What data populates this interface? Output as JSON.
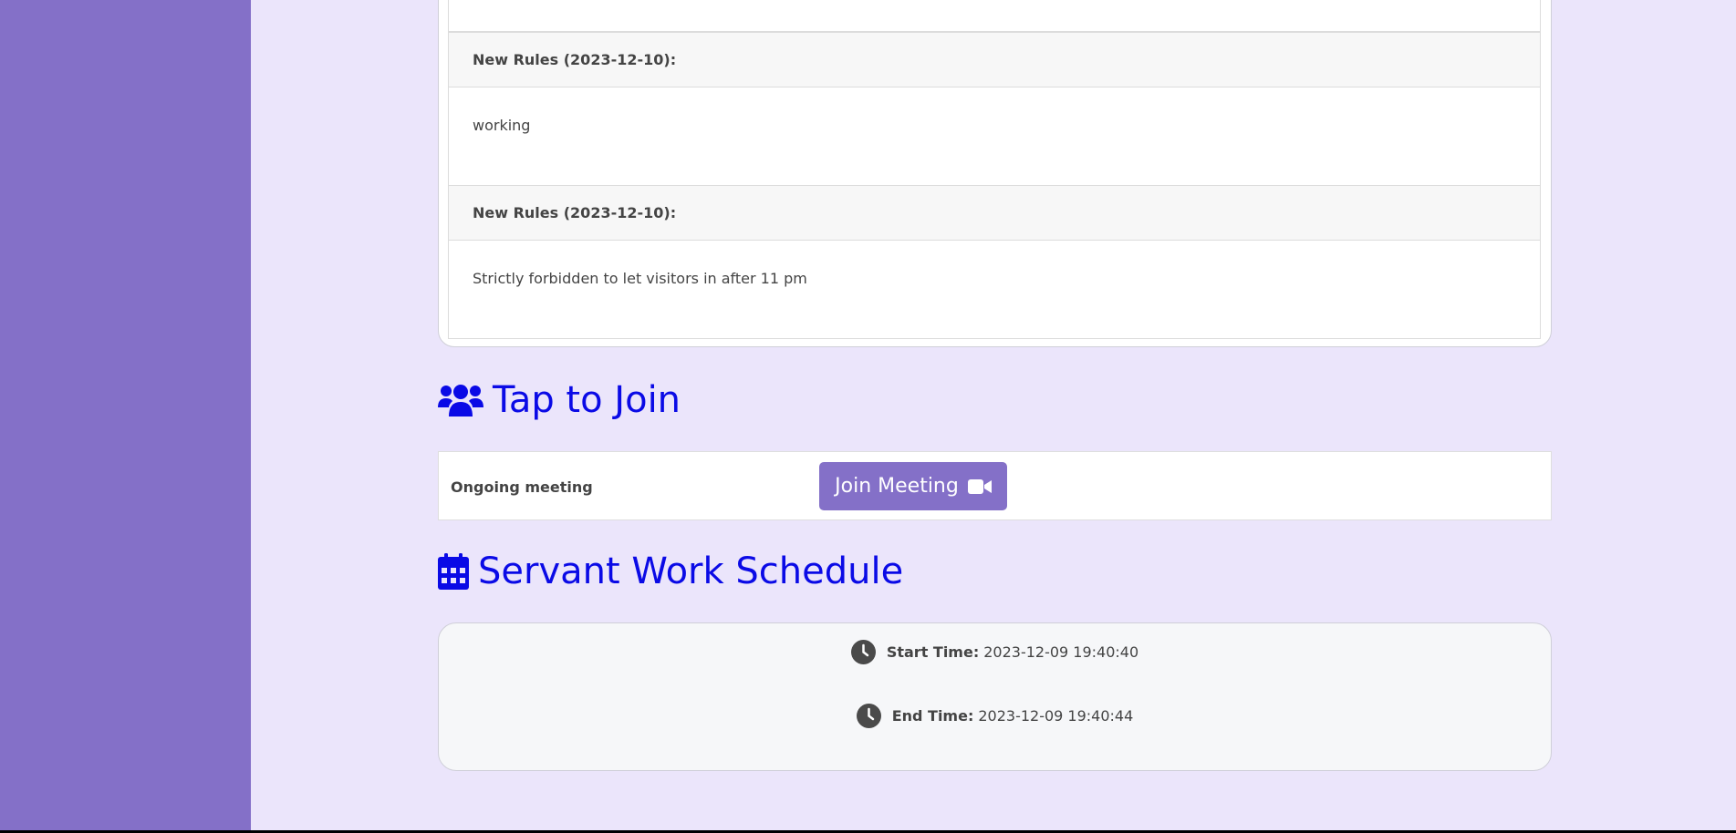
{
  "colors": {
    "sidebar": "#8470c8",
    "background": "#ebe5fb",
    "heading": "#0a0ae6",
    "button": "#8470c8"
  },
  "rules": [
    {
      "title": "New Rules (2023-12-10):",
      "body": "working"
    },
    {
      "title": "New Rules (2023-12-10):",
      "body": "Strictly forbidden to let visitors in after 11 pm"
    }
  ],
  "join": {
    "icon": "users-icon",
    "title": "Tap to Join",
    "meeting_label": "Ongoing meeting",
    "button_label": "Join Meeting",
    "button_icon": "video-camera-icon"
  },
  "schedule": {
    "icon": "calendar-icon",
    "title": "Servant Work Schedule",
    "start_label": "Start Time:",
    "start_value": "2023-12-09 19:40:40",
    "end_label": "End Time:",
    "end_value": "2023-12-09 19:40:44"
  }
}
